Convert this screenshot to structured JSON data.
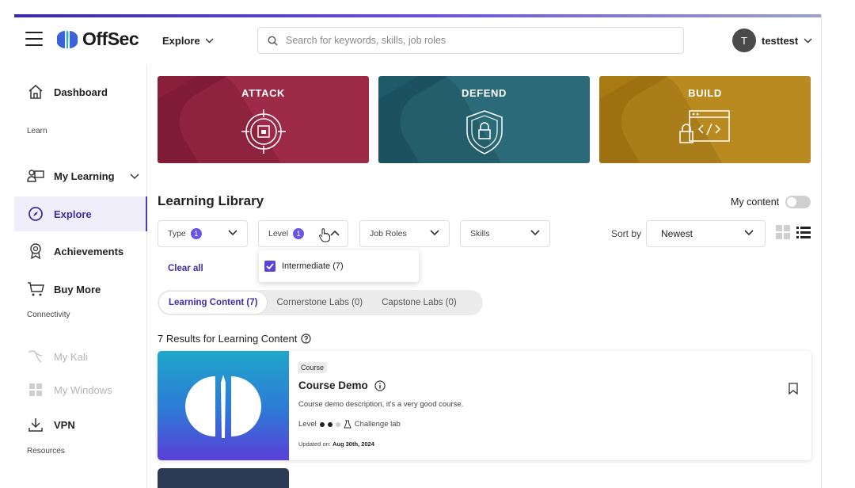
{
  "header": {
    "logo_text": "OffSec",
    "explore_label": "Explore",
    "search_placeholder": "Search for keywords, skills, job roles",
    "user_initial": "T",
    "user_name": "testtest"
  },
  "sidebar": {
    "dashboard": "Dashboard",
    "section_learn": "Learn",
    "my_learning": "My Learning",
    "explore": "Explore",
    "achievements": "Achievements",
    "buy_more": "Buy More",
    "section_connectivity": "Connectivity",
    "my_kali": "My Kali",
    "my_windows": "My Windows",
    "vpn": "VPN",
    "section_resources": "Resources"
  },
  "banners": {
    "attack": "ATTACK",
    "defend": "DEFEND",
    "build": "BUILD"
  },
  "library": {
    "title": "Learning Library",
    "my_content": "My content",
    "filters": {
      "type": "Type",
      "type_count": "1",
      "level": "Level",
      "level_count": "1",
      "job_roles": "Job Roles",
      "skills": "Skills"
    },
    "sort_by": "Sort by",
    "sort_value": "Newest",
    "clear_all": "Clear all",
    "dropdown_option": "Intermediate (7)",
    "tabs": [
      "Learning Content (7)",
      "Cornerstone Labs (0)",
      "Capstone Labs (0)"
    ],
    "results": "7 Results for Learning Content"
  },
  "card": {
    "badge": "Course",
    "title": "Course Demo",
    "description": "Course demo description, it's a very good course.",
    "level_label": "Level",
    "challenge_lab": "Challenge lab",
    "updated_label": "Updated on:",
    "updated_date": "Aug 30th, 2024"
  },
  "colors": {
    "accent": "#3d2ea7",
    "attack": "#8a1f3a",
    "defend": "#1f5a68",
    "build": "#a87a12"
  }
}
